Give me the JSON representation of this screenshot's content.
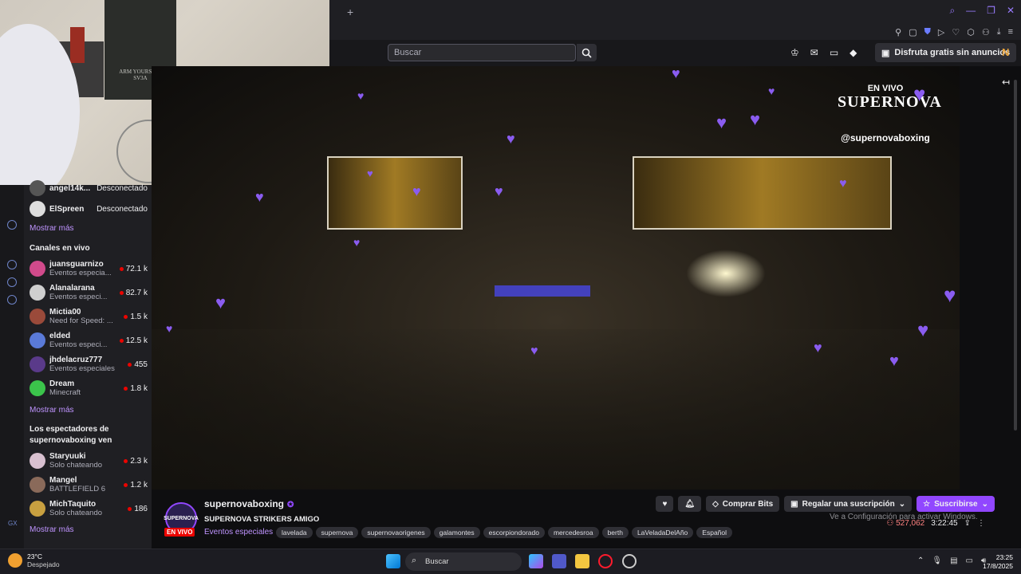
{
  "browser": {
    "newtab_glyph": "+",
    "search_placeholder": "Buscar",
    "promo_label": "Disfruta gratis sin anuncios"
  },
  "sidebar": {
    "followed": [
      {
        "name": "angel14k...",
        "status": "Desconectado"
      },
      {
        "name": "ElSpreen",
        "status": "Desconectado"
      }
    ],
    "show_more": "Mostrar más",
    "live_heading": "Canales en vivo",
    "live_channels": [
      {
        "name": "juansguarnizo",
        "category": "Eventos especia...",
        "viewers": "72.1 k",
        "color": "#d14a8b"
      },
      {
        "name": "Alanalarana",
        "category": "Eventos especi...",
        "viewers": "82.7 k",
        "color": "#cfcfcf"
      },
      {
        "name": "Mictia00",
        "category": "Need for Speed: ...",
        "viewers": "1.5 k",
        "color": "#9a4a3a"
      },
      {
        "name": "elded",
        "category": "Eventos especi...",
        "viewers": "12.5 k",
        "color": "#5a7ad8"
      },
      {
        "name": "jhdelacruz777",
        "category": "Eventos especiales",
        "viewers": "455",
        "color": "#5a3a8a"
      },
      {
        "name": "Dream",
        "category": "Minecraft",
        "viewers": "1.8 k",
        "color": "#3bc44b"
      }
    ],
    "viewers_heading": "Los espectadores de supernovaboxing ven",
    "viewer_channels": [
      {
        "name": "Staryuuki",
        "category": "Solo chateando",
        "viewers": "2.3 k",
        "color": "#d8c0d0"
      },
      {
        "name": "Mangel",
        "category": "BATTLEFIELD 6",
        "viewers": "1.2 k",
        "color": "#8a6a5a"
      },
      {
        "name": "MichTaquito",
        "category": "Solo chateando",
        "viewers": "186",
        "color": "#c8a040"
      }
    ]
  },
  "video": {
    "overlay_live": "EN VIVO",
    "overlay_brand": "SUPERNOVA",
    "overlay_handle": "@supernovaboxing"
  },
  "stream": {
    "channel": "supernovaboxing",
    "live_badge": "EN VIVO",
    "avatar_text": "SUPERNOVA",
    "title": "SUPERNOVA STRIKERS AMIGO",
    "category": "Eventos especiales",
    "tags": [
      "lavelada",
      "supernova",
      "supernovaorigenes",
      "galamontes",
      "escorpiondorado",
      "mercedesroa",
      "berth",
      "LaVeladaDelAño",
      "Español"
    ],
    "buy_bits": "Comprar Bits",
    "gift_sub": "Regalar una suscripción",
    "subscribe": "Suscribirse",
    "viewers": "527,062",
    "uptime": "3:22:45",
    "activate_windows": "Ve a Configuración para activar Windows."
  },
  "taskbar": {
    "temp": "23°C",
    "weather": "Despejado",
    "search": "Buscar",
    "time": "23:25",
    "date": "17/8/2025"
  },
  "colors": {
    "accent": "#9147ff",
    "live": "#eb0400",
    "link": "#bf94ff"
  }
}
